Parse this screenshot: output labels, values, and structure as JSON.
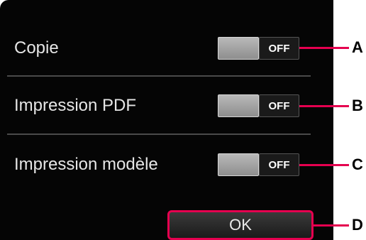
{
  "settings": [
    {
      "label": "Copie",
      "state": "OFF",
      "callout": "A"
    },
    {
      "label": "Impression PDF",
      "state": "OFF",
      "callout": "B"
    },
    {
      "label": "Impression modèle",
      "state": "OFF",
      "callout": "C"
    }
  ],
  "ok_button": {
    "label": "OK",
    "callout": "D"
  },
  "colors": {
    "screen_background": "#050505",
    "callout_accent": "#e5004f",
    "toggle_knob": "#a3a3a3"
  }
}
